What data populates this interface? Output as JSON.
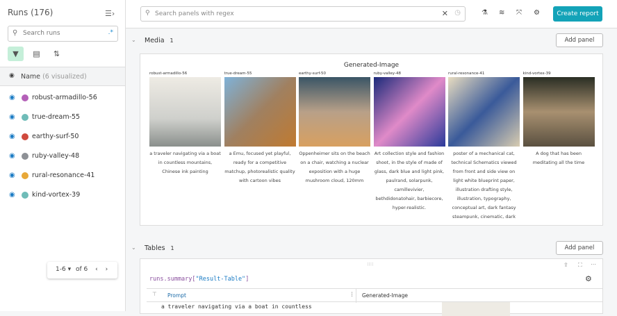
{
  "sidebar": {
    "title": "Runs (176)",
    "search_placeholder": "Search runs",
    "regex": ".*",
    "name_header": "Name",
    "visualized": "(6 visualized)",
    "runs": [
      {
        "name": "robust-armadillo-56",
        "color": "#b460b8"
      },
      {
        "name": "true-dream-55",
        "color": "#6fbcb8"
      },
      {
        "name": "earthy-surf-50",
        "color": "#d04a3e"
      },
      {
        "name": "ruby-valley-48",
        "color": "#8e9196"
      },
      {
        "name": "rural-resonance-41",
        "color": "#e8a838"
      },
      {
        "name": "kind-vortex-39",
        "color": "#6fbcb8"
      }
    ],
    "pager": {
      "range": "1-6",
      "of": "of 6"
    }
  },
  "topbar": {
    "search_placeholder": "Search panels with regex",
    "create_report": "Create report"
  },
  "media": {
    "title": "Media",
    "count": "1",
    "add_panel": "Add panel",
    "panel_title": "Generated-Image",
    "images": [
      {
        "run": "robust-armadillo-56",
        "caption": "a traveler navigating via a boat in countless mountains, Chinese ink painting"
      },
      {
        "run": "true-dream-55",
        "caption": "a Emu, focused yet playful, ready for a competitive matchup, photorealistic quality with cartoon vibes"
      },
      {
        "run": "earthy-surf-50",
        "caption": "Oppenheimer sits on the beach on a chair, watching a nuclear exposition with a huge mushroom cloud, 120mm"
      },
      {
        "run": "ruby-valley-48",
        "caption": "Art collection style and fashion shoot, in the style of made of glass, dark blue and light pink, paulrand, solarpunk, camillevivier, bethdidonatohair, barbiecore, hyper-realistic."
      },
      {
        "run": "rural-resonance-41",
        "caption": "poster of a mechanical cat, technical Schematics viewed from front and side view on light white blueprint paper, illustration drafting style, illustration, typography, conceptual art, dark fantasy steampunk, cinematic, dark"
      },
      {
        "run": "kind-vortex-39",
        "caption": "A dog that has been meditating all the time"
      }
    ]
  },
  "tables": {
    "title": "Tables",
    "count": "1",
    "add_panel": "Add panel",
    "code_prefix": "runs.summary[",
    "code_key": "\"Result-Table\"",
    "code_suffix": "]",
    "col_prompt": "Prompt",
    "col_image": "Generated-Image",
    "row1_prompt": "a traveler navigating via a boat in countless"
  }
}
